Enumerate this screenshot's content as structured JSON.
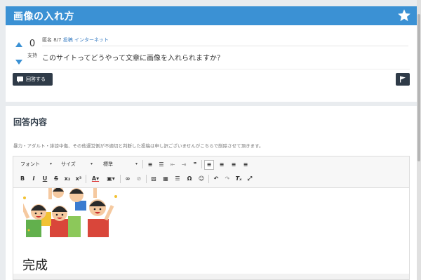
{
  "question_card": {
    "title": "画像の入れ方",
    "vote_count": "0",
    "vote_label": "支持",
    "meta_prefix": "匿名 8/7",
    "meta_link": "投稿 インターネット",
    "question_text": "このサイトってどうやって文章に画像を入れられますか？",
    "answer_button_label": "回答する"
  },
  "answer_card": {
    "title": "回答内容",
    "notice": "暴力・アダルト・誹謗中傷、その他運営側が不適切と判断した投稿は申し訳ございませんがこちらで削除させて頂きます。",
    "toolbar": {
      "font_select": "フォント",
      "size_select": "サイズ",
      "format_select": "標準"
    },
    "content_heading": "完成"
  },
  "colors": {
    "header_blue": "#3b91d4",
    "dark_button": "#2f3b48"
  }
}
